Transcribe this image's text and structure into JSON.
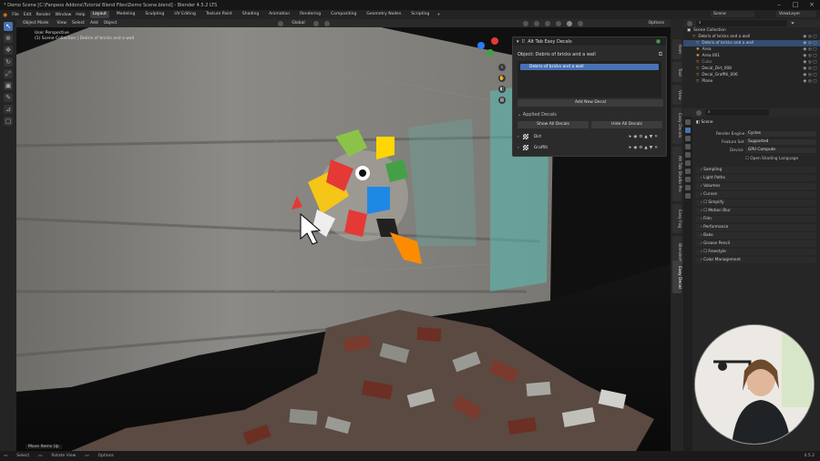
{
  "window": {
    "title": "* Demo Scene [C:\\Fanpess Addons\\Tutorial Blend Files\\Demo Scene.blend] - Blender 4.5.2 LTS"
  },
  "menubar": {
    "menus": [
      "File",
      "Edit",
      "Render",
      "Window",
      "Help"
    ],
    "workspaces": [
      "Layout",
      "Modeling",
      "Sculpting",
      "UV Editing",
      "Texture Paint",
      "Shading",
      "Animation",
      "Rendering",
      "Compositing",
      "Geometry Nodes",
      "Scripting"
    ],
    "add_tab": "+",
    "scene_label": "Scene",
    "view_layer_label": "ViewLayer"
  },
  "viewport_header": {
    "mode": "Object Mode",
    "menus": [
      "View",
      "Select",
      "Add",
      "Object"
    ],
    "orientation": "Global",
    "options": "Options",
    "overlay_text_1": "User Perspective",
    "overlay_text_2": "(1) Scene Collection | Debris of bricks and a wall"
  },
  "decal_panel": {
    "title": "Alt Tab Easy Decals",
    "object_label": "Object: Debris of bricks and a wall",
    "selected_object": "Debris of bricks and a wall",
    "add_button": "Add New Decal",
    "applied_section": "Applied Decals",
    "show_all": "Show All Decals",
    "hide_all": "Hide All Decals",
    "decals": [
      {
        "name": "Dirt"
      },
      {
        "name": "Graffiti"
      }
    ]
  },
  "n_tabs": [
    "Item",
    "Tool",
    "View",
    "Easy Decals",
    "Alt Tab Studio Pro",
    "Easy Fog",
    "BlenderKit",
    "Easy Decal"
  ],
  "outliner": {
    "search_placeholder": "",
    "collection": "Scene Collection",
    "items": [
      {
        "name": "Debris of bricks and a wall",
        "selected": false
      },
      {
        "name": "Debris of bricks and a wall",
        "selected": true
      },
      {
        "name": "Area",
        "selected": false
      },
      {
        "name": "Area.001",
        "selected": false
      },
      {
        "name": "Cube",
        "selected": false
      },
      {
        "name": "Decal_Dirt_008",
        "selected": false
      },
      {
        "name": "Decal_Graffiti_006",
        "selected": false
      },
      {
        "name": "Plane",
        "selected": false
      }
    ]
  },
  "properties": {
    "scene": "Scene",
    "render_engine_label": "Render Engine",
    "render_engine": "Cycles",
    "feature_set_label": "Feature Set",
    "feature_set": "Supported",
    "device_label": "Device",
    "device": "GPU Compute",
    "osl_label": "Open Shading Language",
    "sections": [
      "Sampling",
      "Light Paths",
      "Volumes",
      "Curves",
      "Simplify",
      "Motion Blur",
      "Film",
      "Performance",
      "Bake",
      "Grease Pencil",
      "Freestyle",
      "Color Management"
    ]
  },
  "statusbar": {
    "left": "Select",
    "middle": "Rotate View",
    "right": "Options",
    "operator": "Move Items Up",
    "version": "4.5.2"
  },
  "colors": {
    "accent": "#4772b3",
    "wall": "#8a8a85",
    "graffiti_teal": "#4fd1c5"
  }
}
